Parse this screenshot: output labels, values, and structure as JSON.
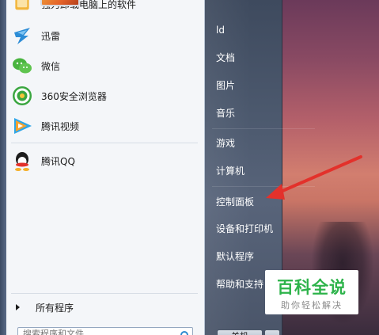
{
  "pinned_programs": [
    {
      "label": "强力卸载电脑上的软件",
      "icon": "uninstall-icon"
    },
    {
      "label": "迅雷",
      "icon": "thunder-icon"
    },
    {
      "label": "微信",
      "icon": "wechat-icon"
    },
    {
      "label": "360安全浏览器",
      "icon": "360-browser-icon"
    },
    {
      "label": "腾讯视频",
      "icon": "tencent-video-icon"
    },
    {
      "label": "腾讯QQ",
      "icon": "qq-icon"
    }
  ],
  "all_programs_label": "所有程序",
  "search": {
    "placeholder": "搜索程序和文件"
  },
  "right_menu": [
    {
      "label": "ld"
    },
    {
      "label": "文档"
    },
    {
      "label": "图片"
    },
    {
      "label": "音乐"
    },
    {
      "label": "游戏"
    },
    {
      "label": "计算机"
    },
    {
      "label": "控制面板"
    },
    {
      "label": "设备和打印机"
    },
    {
      "label": "默认程序"
    },
    {
      "label": "帮助和支持"
    }
  ],
  "shutdown_label": "关机",
  "watermark": {
    "title": "百科全说",
    "subtitle": "助你轻松解决"
  },
  "colors": {
    "annotation_arrow": "#e3312b",
    "watermark_green": "#2db34a"
  }
}
